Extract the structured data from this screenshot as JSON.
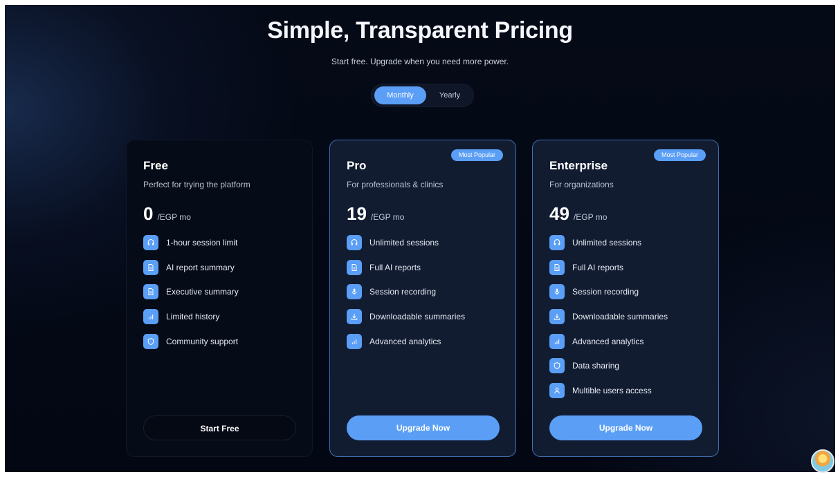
{
  "header": {
    "title": "Simple, Transparent Pricing",
    "subtitle": "Start free. Upgrade when you need more power."
  },
  "billing_toggle": {
    "options": [
      "Monthly",
      "Yearly"
    ],
    "selected": "Monthly"
  },
  "colors": {
    "accent": "#5a9ef6",
    "background": "#040916",
    "card_highlight": "#121c31"
  },
  "plans": [
    {
      "name": "Free",
      "description": "Perfect for trying the platform",
      "price": "0",
      "unit": "/EGP mo",
      "badge": "",
      "cta": "Start Free",
      "features": [
        {
          "icon": "headphones-icon",
          "label": "1-hour session limit"
        },
        {
          "icon": "document-icon",
          "label": "AI report summary"
        },
        {
          "icon": "document-icon",
          "label": "Executive summary"
        },
        {
          "icon": "bar-chart-icon",
          "label": "Limited history"
        },
        {
          "icon": "shield-icon",
          "label": "Community support"
        }
      ]
    },
    {
      "name": "Pro",
      "description": "For professionals & clinics",
      "price": "19",
      "unit": "/EGP mo",
      "badge": "Most Popular",
      "cta": "Upgrade Now",
      "features": [
        {
          "icon": "headphones-icon",
          "label": "Unlimited sessions"
        },
        {
          "icon": "document-icon",
          "label": "Full AI reports"
        },
        {
          "icon": "microphone-icon",
          "label": "Session recording"
        },
        {
          "icon": "download-icon",
          "label": "Downloadable summaries"
        },
        {
          "icon": "bar-chart-icon",
          "label": "Advanced analytics"
        }
      ]
    },
    {
      "name": "Enterprise",
      "description": "For organizations",
      "price": "49",
      "unit": "/EGP mo",
      "badge": "Most Popular",
      "cta": "Upgrade Now",
      "features": [
        {
          "icon": "headphones-icon",
          "label": "Unlimited sessions"
        },
        {
          "icon": "document-icon",
          "label": "Full AI reports"
        },
        {
          "icon": "microphone-icon",
          "label": "Session recording"
        },
        {
          "icon": "download-icon",
          "label": "Downloadable summaries"
        },
        {
          "icon": "bar-chart-icon",
          "label": "Advanced analytics"
        },
        {
          "icon": "shield-icon",
          "label": "Data sharing"
        },
        {
          "icon": "user-icon",
          "label": "Multible users access"
        }
      ]
    }
  ]
}
